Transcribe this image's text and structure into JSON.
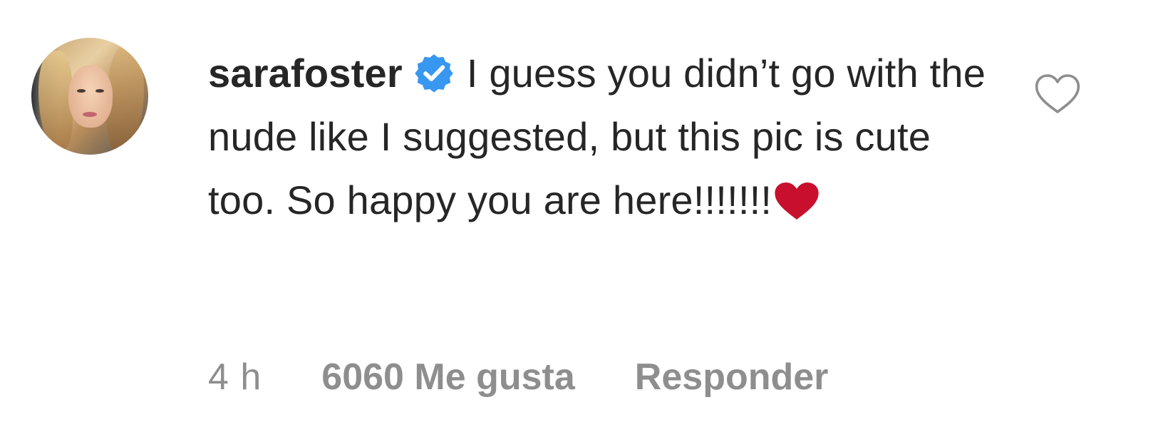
{
  "comment": {
    "username": "sarafoster",
    "verified": true,
    "text": "I guess you didn’t go with the nude like I suggested, but this pic is cute too. So happy you are here!!!!!!!",
    "emoji": "red-heart",
    "time": "4 h",
    "likes_label": "6060 Me gusta",
    "reply_label": "Responder"
  },
  "icons": {
    "avatar": "profile-photo",
    "verified": "verified-badge-icon",
    "like": "heart-outline-icon"
  },
  "colors": {
    "verified_blue": "#3897f0",
    "heart_red": "#c8102e",
    "meta_gray": "#8e8e8e",
    "text_dark": "#262626"
  }
}
